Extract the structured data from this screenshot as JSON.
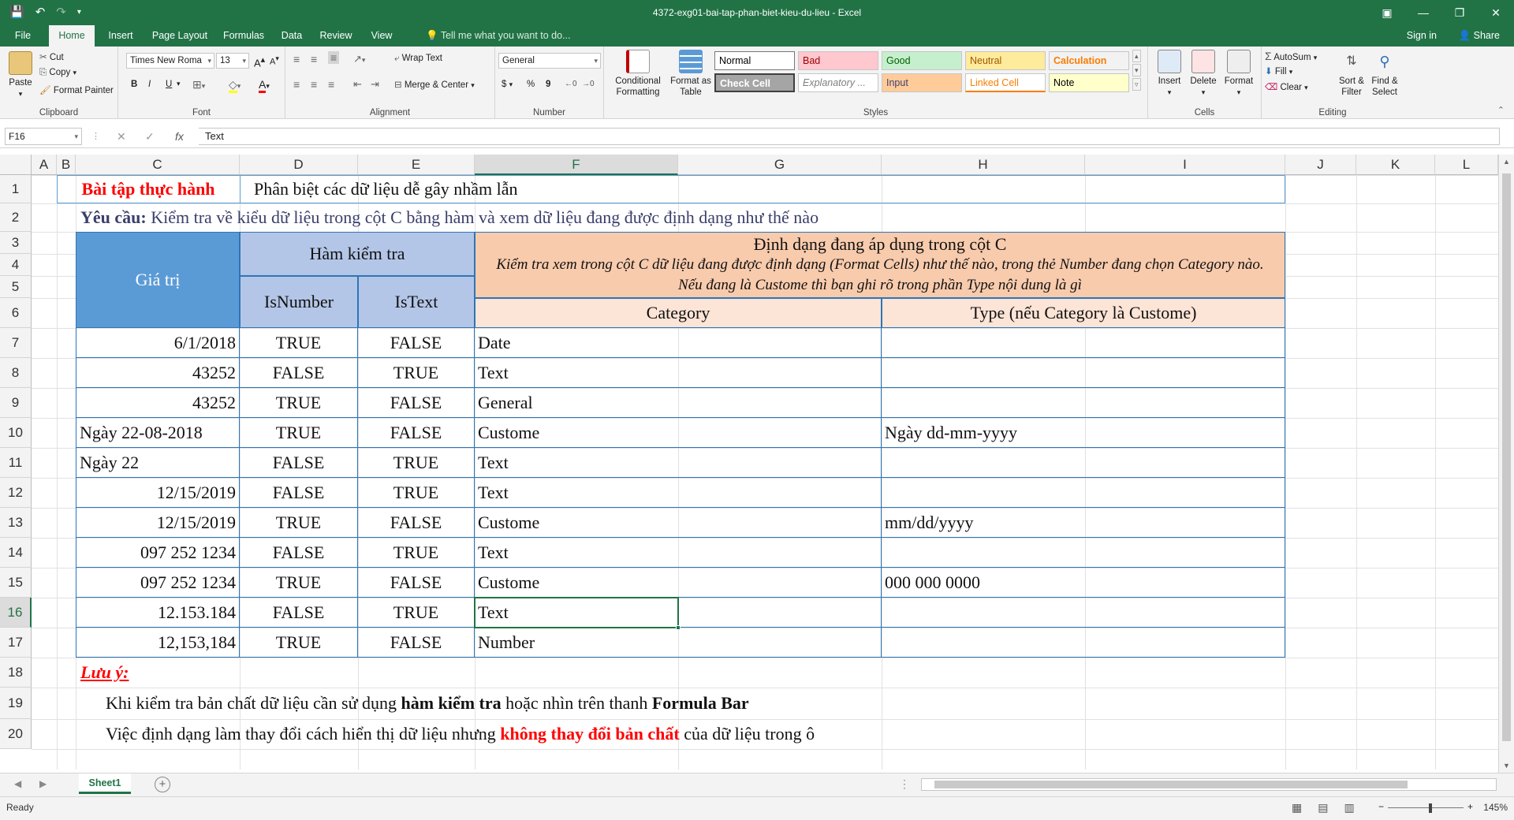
{
  "window": {
    "title": "4372-exg01-bai-tap-phan-biet-kieu-du-lieu - Excel",
    "controls": [
      "▣",
      "—",
      "❐",
      "✕"
    ]
  },
  "tabs": [
    "File",
    "Home",
    "Insert",
    "Page Layout",
    "Formulas",
    "Data",
    "Review",
    "View"
  ],
  "active_tab": "Home",
  "tell_me": "Tell me what you want to do...",
  "sign_in": "Sign in",
  "share": "Share",
  "ribbon": {
    "clipboard": {
      "label": "Clipboard",
      "paste": "Paste",
      "cut": "Cut",
      "copy": "Copy",
      "format_painter": "Format Painter"
    },
    "font": {
      "label": "Font",
      "name": "Times New Roma",
      "size": "13",
      "bold": "B",
      "italic": "I",
      "underline": "U"
    },
    "alignment": {
      "label": "Alignment",
      "wrap": "Wrap Text",
      "merge": "Merge & Center"
    },
    "number": {
      "label": "Number",
      "format": "General",
      "currency": "$",
      "percent": "%",
      "comma": "9"
    },
    "styles": {
      "label": "Styles",
      "conditional": "Conditional Formatting",
      "format_table": "Format as Table",
      "cells": [
        {
          "name": "Normal",
          "bg": "#ffffff",
          "fg": "#000000"
        },
        {
          "name": "Bad",
          "bg": "#ffc7ce",
          "fg": "#9c0006"
        },
        {
          "name": "Good",
          "bg": "#c6efce",
          "fg": "#006100"
        },
        {
          "name": "Neutral",
          "bg": "#ffeb9c",
          "fg": "#9c5700"
        },
        {
          "name": "Calculation",
          "bg": "#f2f2f2",
          "fg": "#fa7d00"
        },
        {
          "name": "Check Cell",
          "bg": "#a5a5a5",
          "fg": "#ffffff"
        },
        {
          "name": "Explanatory ...",
          "bg": "#ffffff",
          "fg": "#7f7f7f"
        },
        {
          "name": "Input",
          "bg": "#ffcc99",
          "fg": "#3f3f76"
        },
        {
          "name": "Linked Cell",
          "bg": "#ffffff",
          "fg": "#fa7d00"
        },
        {
          "name": "Note",
          "bg": "#ffffcc",
          "fg": "#000000"
        }
      ]
    },
    "cells": {
      "label": "Cells",
      "insert": "Insert",
      "delete": "Delete",
      "format": "Format"
    },
    "editing": {
      "label": "Editing",
      "autosum": "AutoSum",
      "fill": "Fill",
      "clear": "Clear",
      "sort": "Sort & Filter",
      "find": "Find & Select"
    }
  },
  "formula_bar": {
    "name_box": "F16",
    "fx": "fx",
    "value": "Text"
  },
  "columns": [
    "A",
    "B",
    "C",
    "D",
    "E",
    "F",
    "G",
    "H",
    "I",
    "J",
    "K",
    "L"
  ],
  "rows": [
    "1",
    "2",
    "3",
    "4",
    "5",
    "6",
    "7",
    "8",
    "9",
    "10",
    "11",
    "12",
    "13",
    "14",
    "15",
    "16",
    "17",
    "18",
    "19",
    "20"
  ],
  "sheet": {
    "title": "Bài tập thực hành",
    "subtitle": "Phân biệt các dữ liệu dễ gây nhầm lẫn",
    "req_label": "Yêu cầu:",
    "req_text": " Kiểm tra về kiểu dữ liệu trong cột C bằng hàm và xem dữ liệu đang được định dạng như thế nào",
    "hdr_value": "Giá trị",
    "hdr_func": "Hàm kiểm tra",
    "hdr_isnumber": "IsNumber",
    "hdr_istext": "IsText",
    "hdr_format": "Định dạng đang áp dụng trong cột C",
    "hdr_format_desc": "Kiểm tra xem trong cột C dữ liệu đang được định dạng (Format Cells) như thế nào, trong thẻ Number đang chọn Category nào. Nếu đang là Custome thì bạn ghi rõ trong phần Type nội dung là gì",
    "hdr_category": "Category",
    "hdr_type": "Type (nếu Category là Custome)",
    "data_rows": [
      {
        "value": "6/1/2018",
        "align": "right",
        "isnumber": "TRUE",
        "istext": "FALSE",
        "category": "Date",
        "type": ""
      },
      {
        "value": "43252",
        "align": "right",
        "isnumber": "FALSE",
        "istext": "TRUE",
        "category": "Text",
        "type": ""
      },
      {
        "value": "43252",
        "align": "right",
        "isnumber": "TRUE",
        "istext": "FALSE",
        "category": "General",
        "type": ""
      },
      {
        "value": "Ngày 22-08-2018",
        "align": "left",
        "isnumber": "TRUE",
        "istext": "FALSE",
        "category": "Custome",
        "type": "Ngày dd-mm-yyyy"
      },
      {
        "value": "Ngày 22",
        "align": "left",
        "isnumber": "FALSE",
        "istext": "TRUE",
        "category": "Text",
        "type": ""
      },
      {
        "value": "12/15/2019",
        "align": "right",
        "isnumber": "FALSE",
        "istext": "TRUE",
        "category": "Text",
        "type": ""
      },
      {
        "value": "12/15/2019",
        "align": "right",
        "isnumber": "TRUE",
        "istext": "FALSE",
        "category": "Custome",
        "type": "mm/dd/yyyy"
      },
      {
        "value": "097 252 1234",
        "align": "right",
        "isnumber": "FALSE",
        "istext": "TRUE",
        "category": "Text",
        "type": ""
      },
      {
        "value": "097 252 1234",
        "align": "right",
        "isnumber": "TRUE",
        "istext": "FALSE",
        "category": "Custome",
        "type": "000 000 0000"
      },
      {
        "value": "12.153.184",
        "align": "right",
        "isnumber": "FALSE",
        "istext": "TRUE",
        "category": "Text",
        "type": ""
      },
      {
        "value": "12,153,184",
        "align": "right",
        "isnumber": "TRUE",
        "istext": "FALSE",
        "category": "Number",
        "type": ""
      }
    ],
    "note_label": "Lưu ý:",
    "note1_a": "Khi kiểm tra bản chất dữ liệu cần sử dụng ",
    "note1_b": "hàm kiểm tra",
    "note1_c": " hoặc nhìn trên thanh ",
    "note1_d": "Formula Bar",
    "note2_a": "Việc định dạng làm thay đổi cách hiển thị dữ liệu nhưng ",
    "note2_b": "không thay đổi bản chất",
    "note2_c": " của dữ liệu trong ô"
  },
  "sheet_tab": "Sheet1",
  "status": "Ready",
  "zoom": "145%",
  "colors": {
    "excel_green": "#217346",
    "header_blue": "#5b9bd5",
    "header_light_blue": "#b4c6e7",
    "header_orange": "#f8cbad",
    "header_light_orange": "#fce4d6",
    "accent_red": "#ff0000"
  }
}
